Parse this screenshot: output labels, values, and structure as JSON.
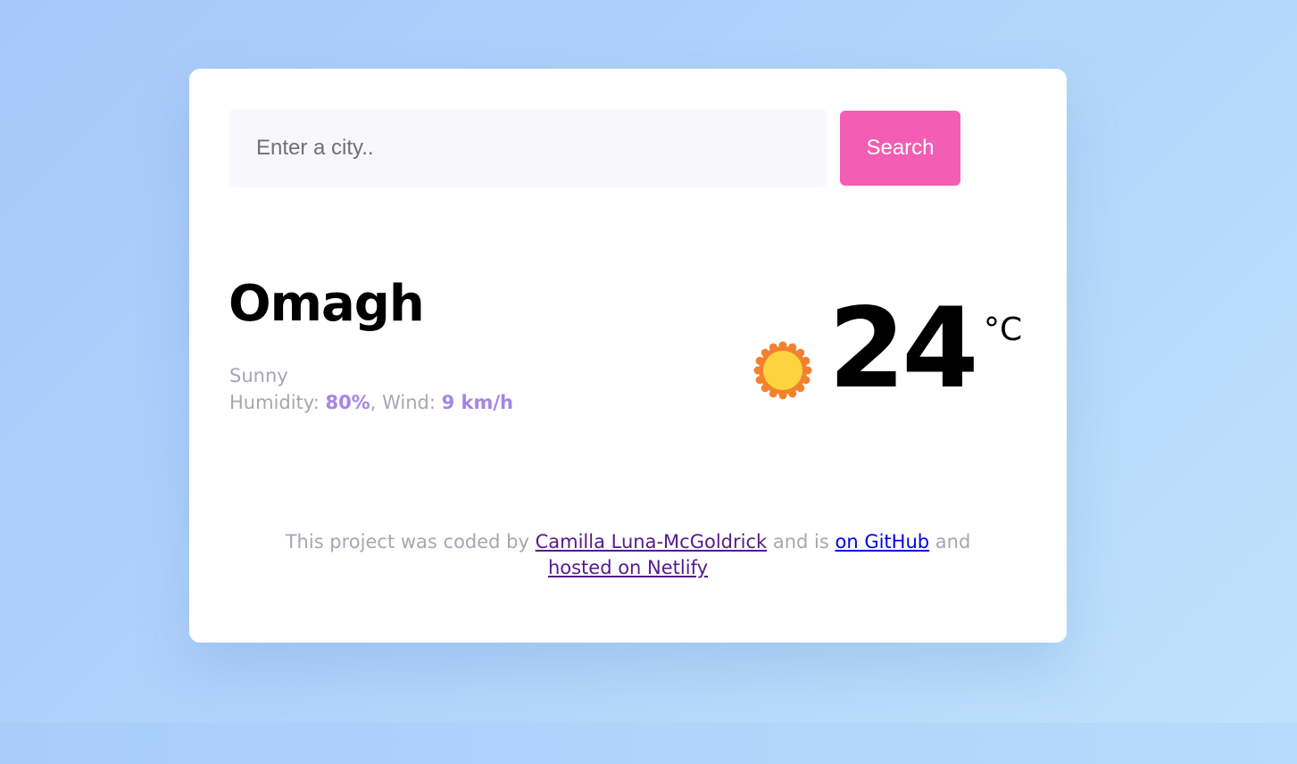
{
  "search": {
    "placeholder": "Enter a city..",
    "value": "",
    "button_label": "Search"
  },
  "weather": {
    "city": "Omagh",
    "description": "Sunny",
    "humidity_label": "Humidity: ",
    "humidity_value": "80%",
    "wind_label": ", Wind: ",
    "wind_value": "9 km/h",
    "icon": "sun-icon",
    "temperature": "24",
    "unit": "°C"
  },
  "footer": {
    "text_1": "This project was coded by ",
    "author_link": "Camilla Luna-McGoldrick",
    "text_2": " and is ",
    "github_link": "on GitHub",
    "text_3": " and",
    "netlify_link": "hosted on Netlify"
  },
  "colors": {
    "background_start": "#a6c8fb",
    "background_end": "#bfe3fb",
    "button": "#f35db3",
    "accent_value": "#a685e6",
    "muted_text": "#a8a5b3",
    "sun_fill": "#fdd33e",
    "sun_rays": "#f5812f"
  }
}
